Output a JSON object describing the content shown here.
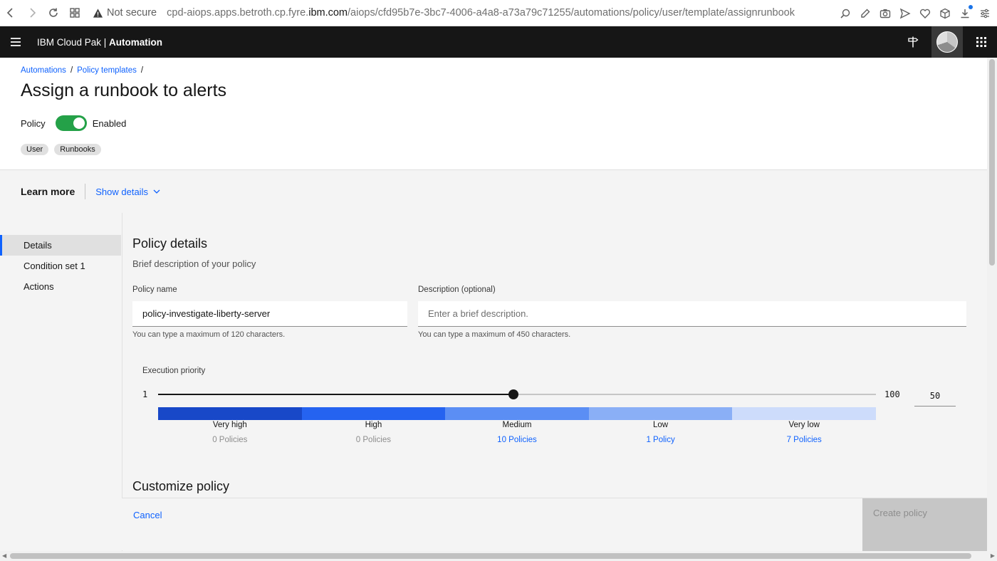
{
  "browser": {
    "security_label": "Not secure",
    "url_host": "cpd-aiops.apps.betroth.cp.fyre.",
    "url_domain": "ibm.com",
    "url_path": "/aiops/cfd95b7e-3bc7-4006-a4a8-a73a79c71255/automations/policy/user/template/assignrunbook"
  },
  "header": {
    "app_name_prefix": "IBM Cloud Pak | ",
    "app_name_bold": "Automation"
  },
  "breadcrumb": {
    "items": [
      "Automations",
      "Policy templates"
    ],
    "separator": "/"
  },
  "page": {
    "title": "Assign a runbook to alerts",
    "policy_label": "Policy",
    "policy_state": "Enabled",
    "tags": [
      "User",
      "Runbooks"
    ]
  },
  "learn_more": {
    "title": "Learn more",
    "toggle_label": "Show details"
  },
  "side_nav": {
    "items": [
      "Details",
      "Condition set 1",
      "Actions"
    ],
    "active": "Details"
  },
  "details": {
    "title": "Policy details",
    "subtitle": "Brief description of your policy",
    "policy_name_label": "Policy name",
    "policy_name_value": "policy-investigate-liberty-server",
    "policy_name_helper": "You can type a maximum of 120 characters.",
    "description_label": "Description (optional)",
    "description_placeholder": "Enter a brief description.",
    "description_helper": "You can type a maximum of 450 characters."
  },
  "priority": {
    "label": "Execution priority",
    "min": "1",
    "max": "100",
    "value": "50",
    "value_num": 50,
    "bands": [
      {
        "name": "Very high",
        "count": "0 Policies",
        "color": "#1848c8",
        "link": false
      },
      {
        "name": "High",
        "count": "0 Policies",
        "color": "#2563f0",
        "link": false
      },
      {
        "name": "Medium",
        "count": "10 Policies",
        "color": "#5b8ef4",
        "link": true
      },
      {
        "name": "Low",
        "count": "1 Policy",
        "color": "#8aaff6",
        "link": true
      },
      {
        "name": "Very low",
        "count": "7 Policies",
        "color": "#cddcfb",
        "link": true
      }
    ]
  },
  "customize": {
    "title": "Customize policy"
  },
  "footer": {
    "cancel_label": "Cancel",
    "create_label": "Create policy"
  }
}
